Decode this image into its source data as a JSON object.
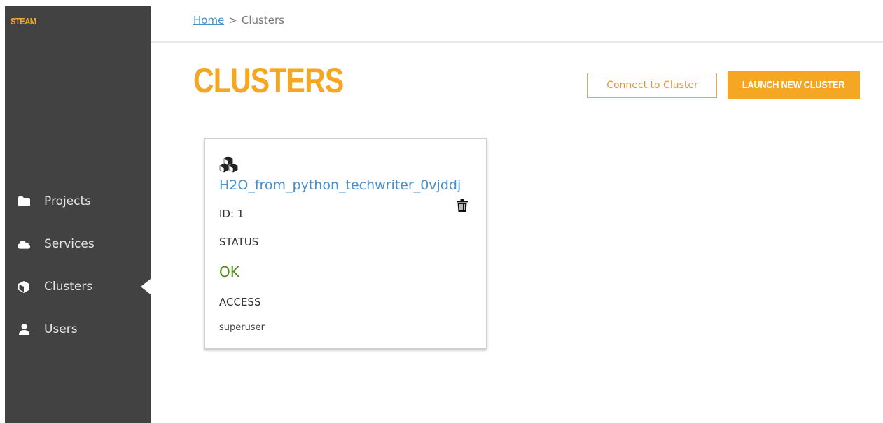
{
  "app": {
    "brand": "STEAM"
  },
  "sidebar": {
    "items": [
      {
        "label": "Projects",
        "icon": "folder-icon"
      },
      {
        "label": "Services",
        "icon": "cloud-icon"
      },
      {
        "label": "Clusters",
        "icon": "cube-icon",
        "active": true
      },
      {
        "label": "Users",
        "icon": "user-icon"
      }
    ]
  },
  "breadcrumb": {
    "home": "Home",
    "separator": ">",
    "current": "Clusters"
  },
  "page": {
    "title": "CLUSTERS"
  },
  "toolbar": {
    "connect_label": "Connect to Cluster",
    "launch_label": "LAUNCH NEW CLUSTER"
  },
  "cluster_card": {
    "icon": "cubes-icon",
    "name": "H2O_from_python_techwriter_0vjddj",
    "id_text": "ID: 1",
    "status_label": "STATUS",
    "status_value": "OK",
    "access_label": "ACCESS",
    "access_value": "superuser"
  },
  "colors": {
    "accent": "#f5a623",
    "sidebar_bg": "#424242",
    "link": "#4a90c8",
    "status_ok": "#4a8a14"
  }
}
